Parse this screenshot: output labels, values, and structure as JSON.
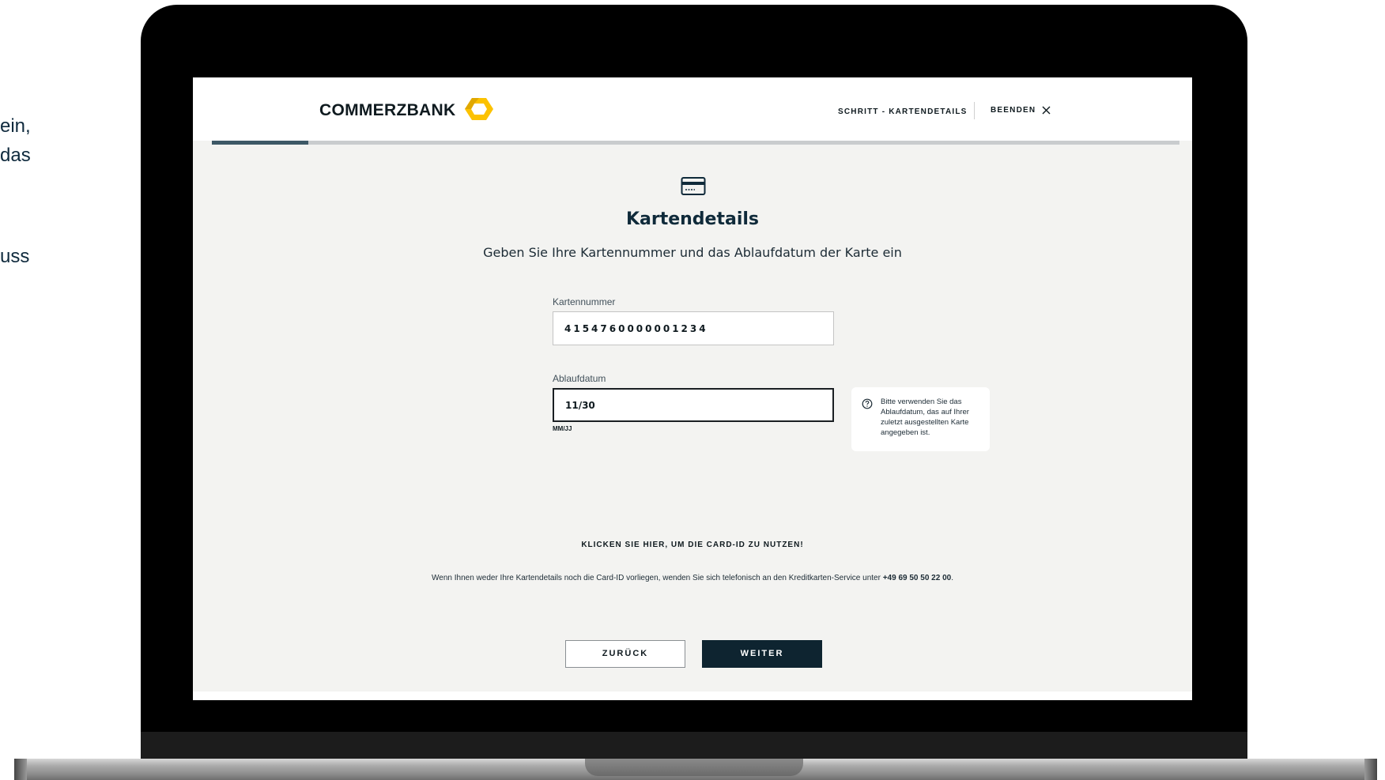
{
  "side_text": {
    "line1": "ein,",
    "line2": "das",
    "line3": "uss"
  },
  "header": {
    "logo_text": "COMMERZBANK",
    "step_label": "SCHRITT - KARTENDETAILS",
    "exit_label": "BEENDEN"
  },
  "progress": {
    "fraction": 0.1
  },
  "main": {
    "title": "Kartendetails",
    "subtitle": "Geben Sie Ihre Kartennummer und das Ablaufdatum der Karte ein",
    "card_number": {
      "label": "Kartennummer",
      "value": "4154760000001234"
    },
    "expiry": {
      "label": "Ablaufdatum",
      "value": "11/30",
      "format_hint": "MM/JJ"
    },
    "info_text": "Bitte verwenden Sie das Ablaufdatum, das auf Ihrer zuletzt ausgestellten Karte angegeben ist.",
    "card_id_link": "KLICKEN SIE HIER, UM DIE CARD-ID ZU NUTZEN!",
    "help_text": "Wenn Ihnen weder Ihre Kartendetails noch die Card-ID vorliegen, wenden Sie sich telefonisch an den Kreditkarten-Service unter ",
    "help_phone": "+49 69 50 50 22 00",
    "help_suffix": "."
  },
  "buttons": {
    "back": "ZURÜCK",
    "next": "WEITER"
  },
  "colors": {
    "brand_yellow": "#fcc200",
    "primary_dark": "#0e2430",
    "progress_fill": "#3d5866"
  }
}
